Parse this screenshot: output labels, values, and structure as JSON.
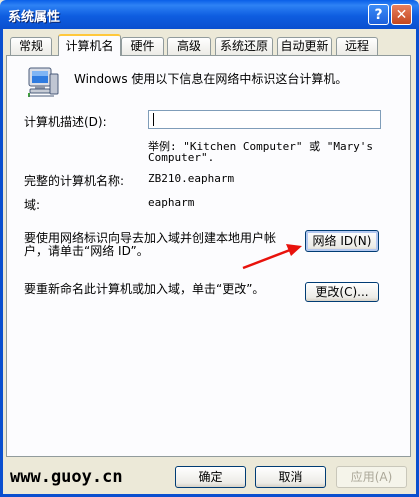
{
  "window": {
    "title": "系统属性",
    "help_label": "?",
    "close_label": "✕"
  },
  "tabs": [
    {
      "label": "常规",
      "active": false
    },
    {
      "label": "计算机名",
      "active": true
    },
    {
      "label": "硬件",
      "active": false
    },
    {
      "label": "高级",
      "active": false
    },
    {
      "label": "系统还原",
      "active": false
    },
    {
      "label": "自动更新",
      "active": false
    },
    {
      "label": "远程",
      "active": false
    }
  ],
  "panel": {
    "intro": "Windows 使用以下信息在网络中标识这台计算机。",
    "description_label": "计算机描述(D):",
    "description_value": "",
    "example_line1": "举例: \"Kitchen Computer\" 或 \"Mary's",
    "example_line2": "Computer\".",
    "full_name_label": "完整的计算机名称:",
    "full_name_value": "ZB210.eapharm",
    "domain_label": "域:",
    "domain_value": "eapharm",
    "network_id_text_line1": "要使用网络标识向导去加入域并创建本地用户帐",
    "network_id_text_line2": "户，请单击“网络 ID”。",
    "network_id_button": "网络 ID(N)",
    "rename_text": "要重新命名此计算机或加入域，单击“更改”。",
    "change_button": "更改(C)..."
  },
  "footer": {
    "watermark": "www.guoy.cn",
    "ok_button": "确定",
    "cancel_button": "取消",
    "apply_button": "应用(A)"
  },
  "colors": {
    "titlebar": "#0A5FE8",
    "dialog_bg": "#ECE9D8",
    "arrow": "#E8120C",
    "active_tab_accent": "#FFC83C"
  },
  "icons": {
    "computer": "computer-network-icon",
    "arrow": "red-arrow-annotation"
  }
}
